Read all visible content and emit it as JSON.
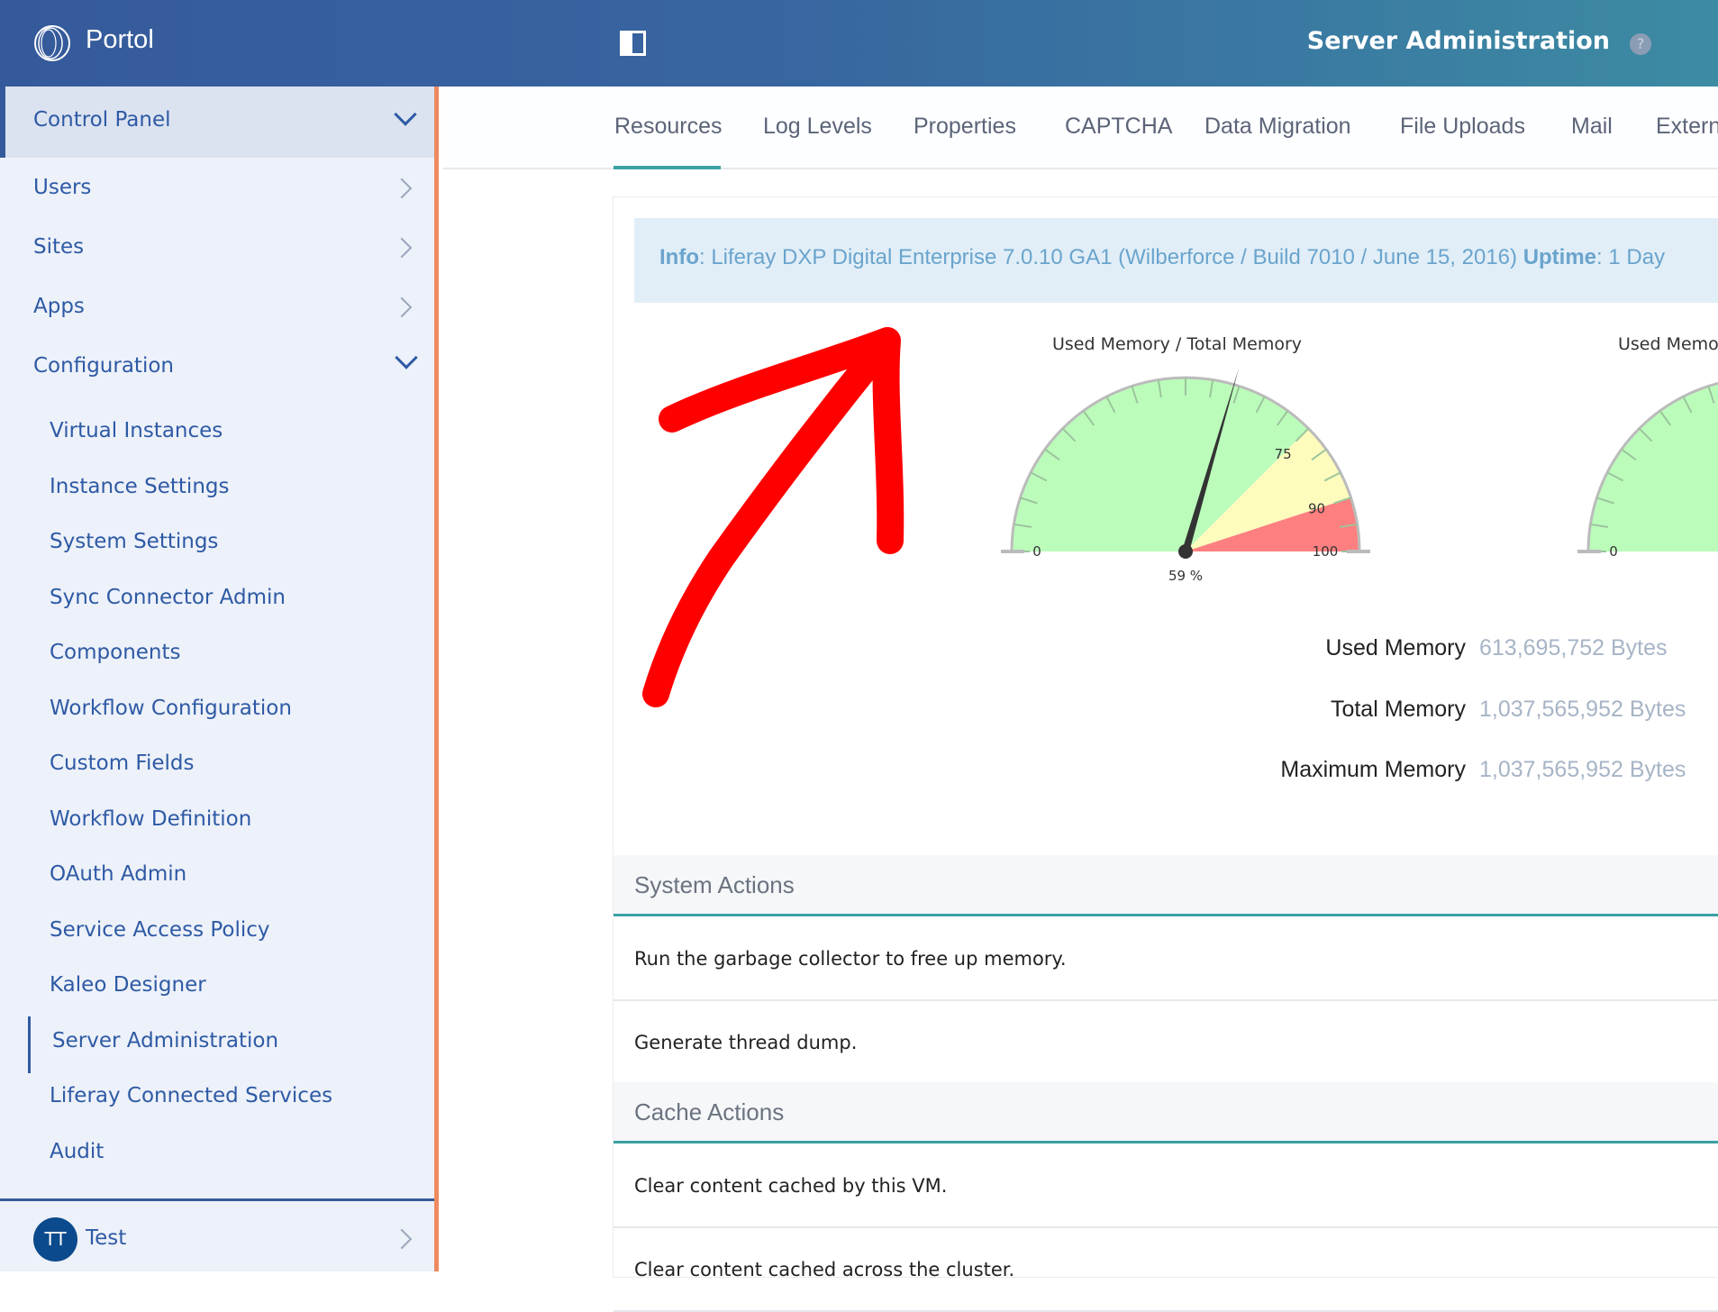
{
  "header": {
    "brand": "Portol",
    "title": "Server Administration",
    "help": "?"
  },
  "sidebar": {
    "control_panel": "Control Panel",
    "items": [
      {
        "label": "Users"
      },
      {
        "label": "Sites"
      },
      {
        "label": "Apps"
      },
      {
        "label": "Configuration"
      }
    ],
    "config_items": [
      "Virtual Instances",
      "Instance Settings",
      "System Settings",
      "Sync Connector Admin",
      "Components",
      "Workflow Configuration",
      "Custom Fields",
      "Workflow Definition",
      "OAuth Admin",
      "Service Access Policy",
      "Kaleo Designer",
      "Server Administration",
      "Liferay Connected Services",
      "Audit"
    ],
    "active": "Server Administration",
    "user": {
      "initials": "TT",
      "name": "Test"
    }
  },
  "tabs": [
    "Resources",
    "Log Levels",
    "Properties",
    "CAPTCHA",
    "Data Migration",
    "File Uploads",
    "Mail",
    "Extern"
  ],
  "active_tab": "Resources",
  "info": {
    "label": "Info",
    "text": ": Liferay DXP Digital Enterprise 7.0.10 GA1 (Wilberforce / Build 7010 / June 15, 2016) ",
    "uptime_label": "Uptime",
    "uptime": ": 1 Day"
  },
  "gauges": [
    {
      "title": "Used Memory / Total Memory",
      "value": 59,
      "value_label": "59 %",
      "labels": [
        "0",
        "75",
        "90",
        "100"
      ],
      "zones": [
        {
          "from": 0,
          "to": 75,
          "color": "#bbfcbb"
        },
        {
          "from": 75,
          "to": 90,
          "color": "#fdfcbd"
        },
        {
          "from": 90,
          "to": 100,
          "color": "#fd7f7f"
        }
      ]
    },
    {
      "title": "Used Memory",
      "labels": [
        "0"
      ]
    }
  ],
  "memory": [
    {
      "label": "Used Memory",
      "value": "613,695,752 Bytes"
    },
    {
      "label": "Total Memory",
      "value": "1,037,565,952 Bytes"
    },
    {
      "label": "Maximum Memory",
      "value": "1,037,565,952 Bytes"
    }
  ],
  "system_actions": {
    "title": "System Actions",
    "rows": [
      "Run the garbage collector to free up memory.",
      "Generate thread dump."
    ]
  },
  "cache_actions": {
    "title": "Cache Actions",
    "rows": [
      "Clear content cached by this VM.",
      "Clear content cached across the cluster."
    ]
  },
  "annotation": {
    "color": "#ff0000",
    "shape": "arrow"
  }
}
